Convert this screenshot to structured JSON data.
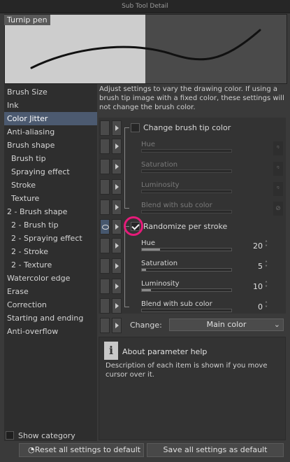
{
  "window": {
    "title": "Sub Tool Detail"
  },
  "preview": {
    "tool_name": "Turnip pen"
  },
  "categories": [
    "Brush Size",
    "Ink",
    "Color Jitter",
    "Anti-aliasing",
    "Brush shape",
    "Brush tip",
    "Spraying effect",
    "Stroke",
    "Texture",
    "2 - Brush shape",
    "2 - Brush tip",
    "2 - Spraying effect",
    "2 - Stroke",
    "2 - Texture",
    "Watercolor edge",
    "Erase",
    "Correction",
    "Starting and ending",
    "Anti-overflow"
  ],
  "selected_category": "Color Jitter",
  "show_category": {
    "label": "Show category",
    "checked": false
  },
  "description": "Adjust settings to vary the drawing color. If using a brush tip image with a fixed color, these settings will not change the brush color.",
  "change_tip_color": {
    "label": "Change brush tip color",
    "checked": false,
    "params": [
      "Hue",
      "Saturation",
      "Luminosity",
      "Blend with sub color"
    ]
  },
  "randomize": {
    "label": "Randomize per stroke",
    "checked": true,
    "params": [
      {
        "label": "Hue",
        "value": "20"
      },
      {
        "label": "Saturation",
        "value": "5"
      },
      {
        "label": "Luminosity",
        "value": "10"
      },
      {
        "label": "Blend with sub color",
        "value": "0"
      }
    ]
  },
  "change": {
    "label": "Change:",
    "value": "Main color"
  },
  "help": {
    "title": "About parameter help",
    "text": "Description of each item is shown if you move cursor over it."
  },
  "buttons": {
    "reset": "Reset all settings to default",
    "save": "Save all settings as default"
  },
  "colors": {
    "selection": "#4c5a70",
    "highlight_circle": "#e61b7a"
  }
}
